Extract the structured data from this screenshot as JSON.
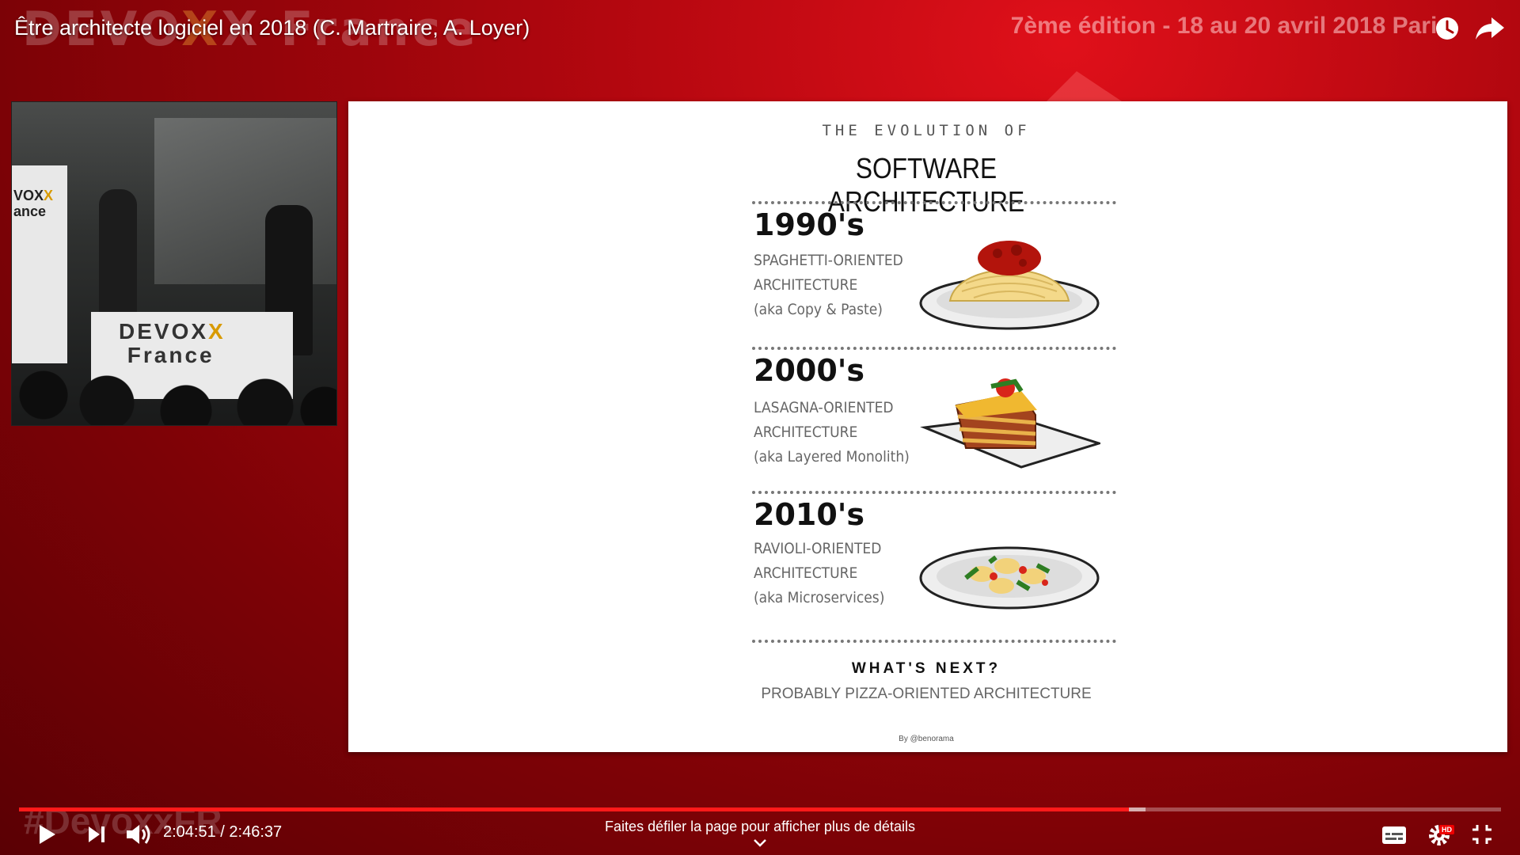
{
  "background": {
    "brand": "DEVOXX France",
    "edition": "7ème édition - 18 au 20 avril 2018 Paris",
    "hashtag": "#DevoxxFR"
  },
  "header": {
    "title": "Être architecte logiciel en 2018 (C. Martraire, A. Loyer)",
    "watch_later_icon": "clock-icon",
    "share_icon": "share-arrow-icon"
  },
  "camera": {
    "banner_text": "VOXX\nance",
    "table_text": "DEVOXX\nFrance"
  },
  "slide": {
    "eyebrow": "THE EVOLUTION OF",
    "title": "SOFTWARE ARCHITECTURE",
    "eras": [
      {
        "decade": "1990's",
        "description": "SPAGHETTI-ORIENTED\nARCHITECTURE\n(aka Copy & Paste)",
        "image": "spaghetti-plate"
      },
      {
        "decade": "2000's",
        "description": "LASAGNA-ORIENTED\nARCHITECTURE\n(aka Layered Monolith)",
        "image": "lasagna-plate"
      },
      {
        "decade": "2010's",
        "description": "RAVIOLI-ORIENTED\nARCHITECTURE\n(aka Microservices)",
        "image": "ravioli-plate"
      }
    ],
    "next_title": "WHAT'S NEXT?",
    "next_subtitle": "PROBABLY PIZZA-ORIENTED ARCHITECTURE",
    "byline": "By @benorama"
  },
  "player": {
    "current_time": "2:04:51",
    "duration": "2:46:37",
    "time_display": "2:04:51 / 2:46:37",
    "progress_fraction": 0.749,
    "buffered_fraction": 0.76,
    "scroll_hint": "Faites défiler la page pour afficher plus de détails",
    "hd_badge": "HD",
    "accent_color": "#ff1a1a"
  }
}
